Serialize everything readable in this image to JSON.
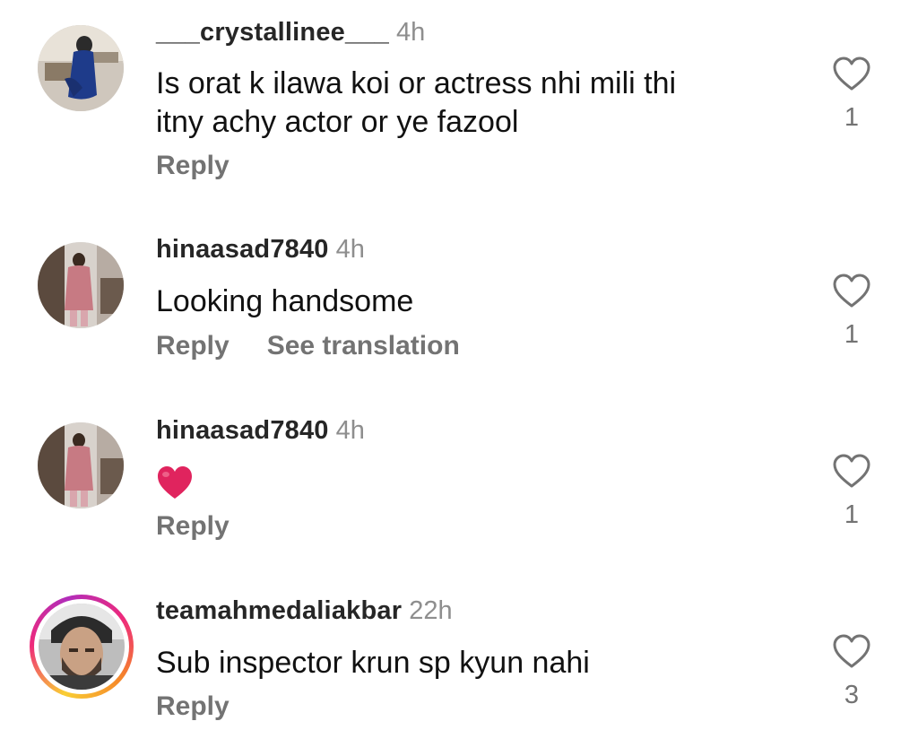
{
  "comments": [
    {
      "username": "___crystallinee___",
      "time": "4h",
      "text_lines": [
        "Is orat k ilawa koi or actress nhi mili thi",
        "itny achy actor or ye fazool"
      ],
      "reply_label": "Reply",
      "likes": "1"
    },
    {
      "username": "hinaasad7840",
      "time": "4h",
      "text_lines": [
        "Looking handsome"
      ],
      "reply_label": "Reply",
      "translate_label": "See translation",
      "likes": "1"
    },
    {
      "username": "hinaasad7840",
      "time": "4h",
      "text_lines": [],
      "emoji": "red-heart-emoji",
      "reply_label": "Reply",
      "likes": "1"
    },
    {
      "username": "teamahmedaliakbar",
      "time": "22h",
      "text_lines": [
        "Sub inspector krun  sp kyun nahi"
      ],
      "reply_label": "Reply",
      "likes": "3",
      "has_story_ring": true
    }
  ],
  "icons": {
    "like": "heart-outline-icon"
  },
  "colors": {
    "username": "#262626",
    "secondary": "#737373",
    "heart_emoji": "#e0245e"
  }
}
